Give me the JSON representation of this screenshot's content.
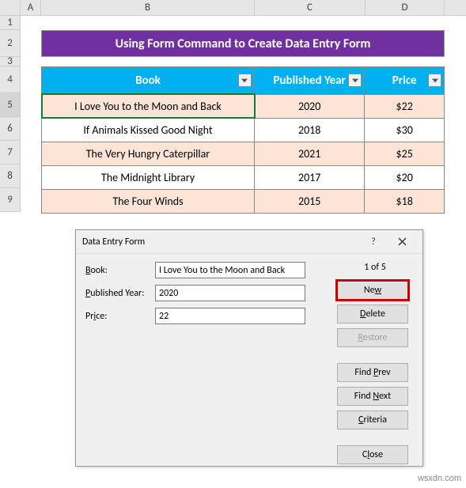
{
  "columns": [
    "A",
    "B",
    "C",
    "D"
  ],
  "rows": [
    "1",
    "2",
    "3",
    "4",
    "5",
    "6",
    "7",
    "8",
    "9"
  ],
  "title": "Using Form Command to Create Data Entry Form",
  "table": {
    "headers": [
      "Book",
      "Published Year",
      "Price"
    ],
    "rows": [
      {
        "book": "I Love You to the Moon and Back",
        "year": "2020",
        "price": "$22"
      },
      {
        "book": "If Animals Kissed Good Night",
        "year": "2018",
        "price": "$30"
      },
      {
        "book": "The Very Hungry Caterpillar",
        "year": "2021",
        "price": "$25"
      },
      {
        "book": "The Midnight Library",
        "year": "2017",
        "price": "$20"
      },
      {
        "book": "The Four Winds",
        "year": "2015",
        "price": "$18"
      }
    ]
  },
  "dialog": {
    "title": "Data Entry Form",
    "help": "?",
    "counter": "1 of 5",
    "fields": {
      "book": {
        "label_pre": "",
        "label_u": "B",
        "label_post": "ook:",
        "value": "I Love You to the Moon and Back"
      },
      "year": {
        "label_pre": "",
        "label_u": "P",
        "label_post": "ublished Year:",
        "value": "2020"
      },
      "price": {
        "label_pre": "Pr",
        "label_u": "i",
        "label_post": "ce:",
        "value": "22"
      }
    },
    "buttons": {
      "new": {
        "pre": "Ne",
        "u": "w",
        "post": ""
      },
      "delete": {
        "pre": "",
        "u": "D",
        "post": "elete"
      },
      "restore": {
        "pre": "",
        "u": "R",
        "post": "estore"
      },
      "findprev": {
        "pre": "Find ",
        "u": "P",
        "post": "rev"
      },
      "findnext": {
        "pre": "Find ",
        "u": "N",
        "post": "ext"
      },
      "criteria": {
        "pre": "",
        "u": "C",
        "post": "riteria"
      },
      "close": {
        "pre": "C",
        "u": "l",
        "post": "ose"
      }
    }
  },
  "watermark": "wsxdn.com"
}
